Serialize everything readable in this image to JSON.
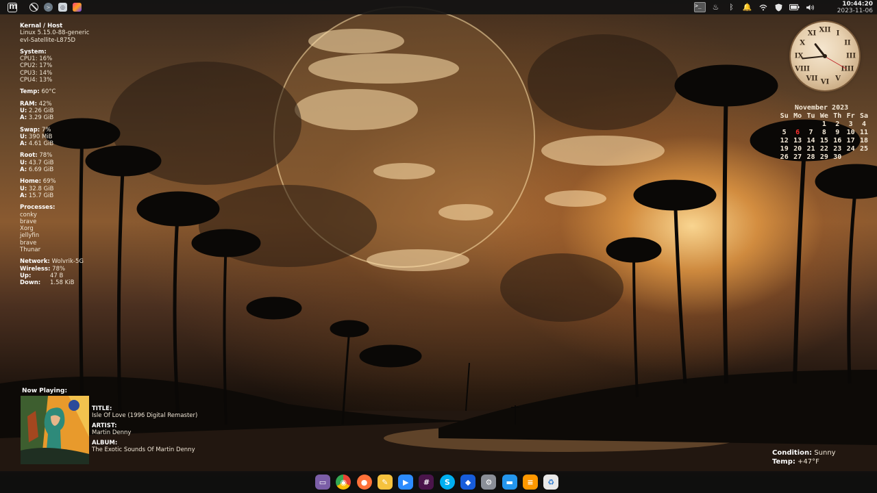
{
  "top_bar": {
    "clock_time": "10:44:20",
    "clock_date": "2023-11-06"
  },
  "sysinfo": {
    "kernel_host_label": "Kernal / Host",
    "kernel": "Linux 5.15.0-88-generic",
    "host": "evl-Satellite-L875D",
    "system_label": "System:",
    "cpus": [
      "CPU1: 16%",
      "CPU2: 17%",
      "CPU3: 14%",
      "CPU4: 13%"
    ],
    "temp_label": "Temp:",
    "temp_value": "60°C",
    "ram_label": "RAM:",
    "ram_value": "42%",
    "ram_used_label": "U:",
    "ram_used": "2.26 GiB",
    "ram_avail_label": "A:",
    "ram_avail": "3.29 GiB",
    "swap_label": "Swap:",
    "swap_value": "7%",
    "swap_used_label": "U:",
    "swap_used": "390 MiB",
    "swap_avail_label": "A:",
    "swap_avail": "4.61 GiB",
    "root_label": "Root:",
    "root_value": "78%",
    "root_used_label": "U:",
    "root_used": "43.7 GiB",
    "root_avail_label": "A:",
    "root_avail": "6.69 GiB",
    "home_label": "Home:",
    "home_value": "69%",
    "home_used_label": "U:",
    "home_used": "32.8 GiB",
    "home_avail_label": "A:",
    "home_avail": "15.7 GiB",
    "processes_label": "Processes:",
    "processes": [
      "conky",
      "brave",
      "Xorg",
      "jellyfin",
      "brave",
      "Thunar"
    ],
    "network_label": "Network:",
    "network_value": "Wolvrik-5G",
    "wireless_label": "Wireless:",
    "wireless_value": "78%",
    "up_label": "Up:",
    "up_value": "47 B",
    "down_label": "Down:",
    "down_value": "1.58 KiB"
  },
  "analog_clock": {
    "numerals": [
      "XII",
      "I",
      "II",
      "III",
      "IIII",
      "V",
      "VI",
      "VII",
      "VIII",
      "IX",
      "X",
      "XI"
    ],
    "hour": 10,
    "minute": 44,
    "second": 20
  },
  "calendar": {
    "month": "November 2023",
    "weekdays": [
      "Su",
      "Mo",
      "Tu",
      "We",
      "Th",
      "Fr",
      "Sa"
    ],
    "weeks": [
      [
        "",
        "",
        "",
        "1",
        "2",
        "3",
        "4"
      ],
      [
        "5",
        "6",
        "7",
        "8",
        "9",
        "10",
        "11"
      ],
      [
        "12",
        "13",
        "14",
        "15",
        "16",
        "17",
        "18"
      ],
      [
        "19",
        "20",
        "21",
        "22",
        "23",
        "24",
        "25"
      ],
      [
        "26",
        "27",
        "28",
        "29",
        "30",
        "",
        ""
      ]
    ],
    "today": "6",
    "today_color": "#ff3030"
  },
  "now_playing": {
    "heading": "Now Playing:",
    "title_label": "TITLE:",
    "title": "Isle Of Love (1996 Digital Remaster)",
    "artist_label": "ARTIST:",
    "artist": "Martin Denny",
    "album_label": "ALBUM:",
    "album": "The Exotic Sounds Of Martin Denny"
  },
  "weather": {
    "condition_label": "Condition:",
    "condition": "Sunny",
    "temp_label": "Temp:",
    "temp": "+47°F"
  },
  "panel_icons": [
    "mint-menu-icon",
    "block-icon",
    "terminal-app-icon",
    "screenshot-icon",
    "color-picker-icon"
  ],
  "tray_icons": [
    "terminal-tray-icon",
    "redshift-icon",
    "bluetooth-icon",
    "notifications-icon",
    "wifi-icon",
    "shield-icon",
    "battery-icon",
    "volume-icon"
  ],
  "dock_apps": [
    {
      "name": "files-icon",
      "color": "#7b5ea7"
    },
    {
      "name": "chrome-icon",
      "color": "#34a853"
    },
    {
      "name": "firefox-icon",
      "color": "#ff7139"
    },
    {
      "name": "notes-icon",
      "color": "#f6c23e"
    },
    {
      "name": "zoom-icon",
      "color": "#2d8cff"
    },
    {
      "name": "slack-icon",
      "color": "#4a154b"
    },
    {
      "name": "skype-icon",
      "color": "#00aff0"
    },
    {
      "name": "bitwarden-icon",
      "color": "#175ddc"
    },
    {
      "name": "settings-icon",
      "color": "#8a8f98"
    },
    {
      "name": "docker-icon",
      "color": "#2496ed"
    },
    {
      "name": "tasks-icon",
      "color": "#ff9800"
    },
    {
      "name": "trash-icon",
      "color": "#e8e8e8"
    }
  ]
}
